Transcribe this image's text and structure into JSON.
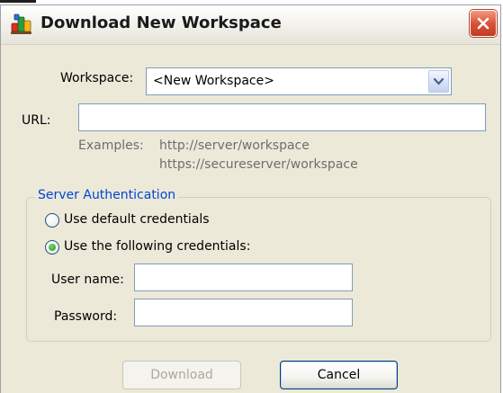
{
  "window": {
    "title": "Download New Workspace"
  },
  "form": {
    "workspace_label": "Workspace:",
    "workspace_value": "<New Workspace>",
    "url_label": "URL:",
    "url_value": "",
    "examples_label": "Examples:",
    "example_1": "http://server/workspace",
    "example_2": "https://secureserver/workspace"
  },
  "auth": {
    "group_title": "Server Authentication",
    "option_default": "Use default credentials",
    "option_following": "Use the following credentials:",
    "selected": "following",
    "username_label": "User name:",
    "username_value": "",
    "password_label": "Password:",
    "password_value": ""
  },
  "buttons": {
    "download": "Download",
    "cancel": "Cancel"
  },
  "icons": {
    "title": "application-icon",
    "close": "close-icon",
    "dropdown": "chevron-down-icon"
  },
  "colors": {
    "dialog_background": "#ece9d8",
    "group_title": "#0046d5",
    "close_button": "#d9533a",
    "input_border": "#7f9db9"
  }
}
